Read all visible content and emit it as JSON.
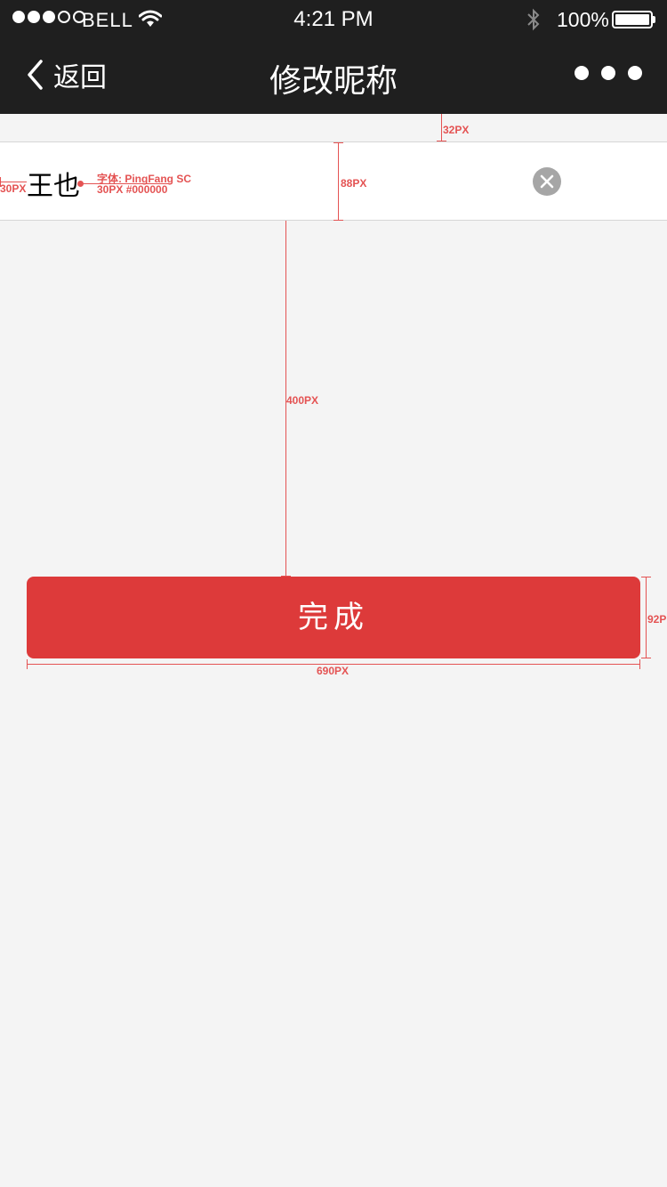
{
  "status_bar": {
    "carrier": "BELL",
    "time": "4:21 PM",
    "battery": "100%",
    "signal_icon": "signal-dots-icon",
    "wifi_icon": "wifi-icon",
    "bluetooth_icon": "bluetooth-icon"
  },
  "nav": {
    "back_label": "返回",
    "title": "修改昵称",
    "more_icon": "more-dots-icon"
  },
  "form": {
    "nickname_value": "王也",
    "clear_icon": "clear-icon"
  },
  "done_button": {
    "label": "完成"
  },
  "annotations": {
    "top_gap": "32PX",
    "row_height": "88PX",
    "left_margin": "30PX",
    "font_spec_line1": "字体: PingFang SC",
    "font_spec_line2": "30PX #000000",
    "gap_to_button": "400PX",
    "button_height": "92P",
    "button_width": "690PX"
  },
  "colors": {
    "nav_background": "#1f1f1f",
    "page_background": "#f4f4f4",
    "button": "#dd3a3a",
    "annotation": "#e45353"
  }
}
